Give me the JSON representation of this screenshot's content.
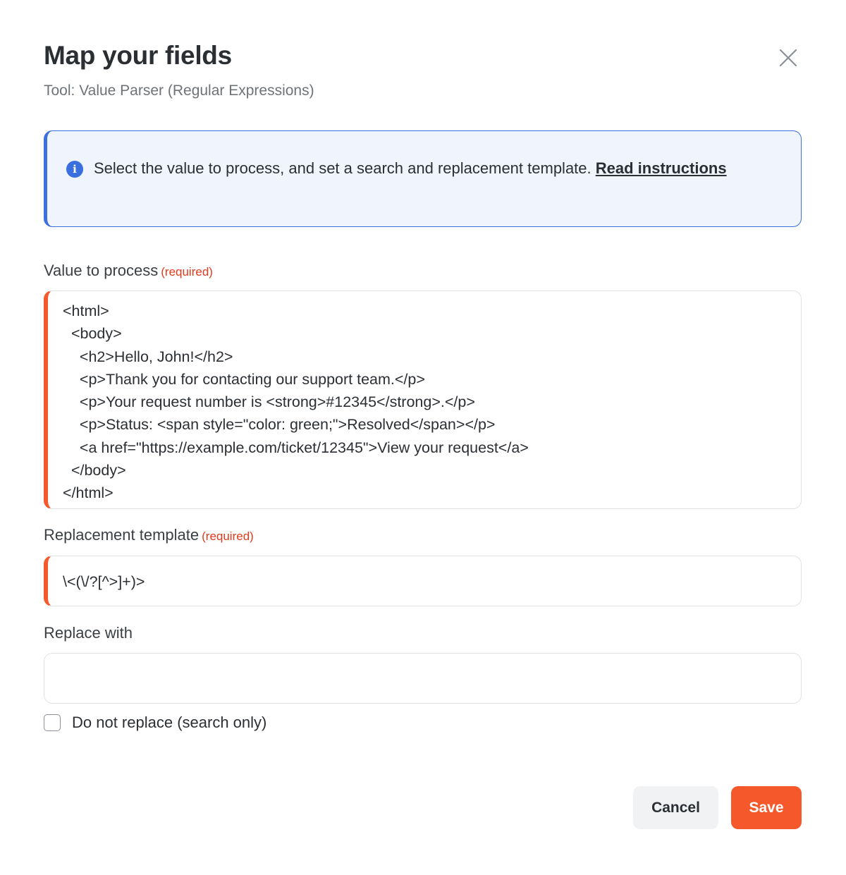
{
  "header": {
    "title": "Map your fields",
    "subtitle": "Tool: Value Parser (Regular Expressions)",
    "close_icon": "close-icon"
  },
  "info": {
    "icon": "info-icon",
    "icon_glyph": "i",
    "text": "Select the value to process, and set a search and replacement template. ",
    "link": "Read instructions",
    "accent_color": "#3a6fe0",
    "background_color": "#eff4fd"
  },
  "fields": {
    "value_to_process": {
      "label": "Value to process",
      "required_label": "(required)",
      "value": "<html>\n  <body>\n    <h2>Hello, John!</h2>\n    <p>Thank you for contacting our support team.</p>\n    <p>Your request number is <strong>#12345</strong>.</p>\n    <p>Status: <span style=\"color: green;\">Resolved</span></p>\n    <a href=\"https://example.com/ticket/12345\">View your request</a>\n  </body>\n</html>"
    },
    "replacement_template": {
      "label": "Replacement template",
      "required_label": "(required)",
      "value": "\\<(\\/?[^>]+)>"
    },
    "replace_with": {
      "label": "Replace with",
      "value": ""
    },
    "search_only": {
      "label": "Do not replace (search only)",
      "checked": false
    }
  },
  "footer": {
    "cancel_label": "Cancel",
    "save_label": "Save"
  },
  "colors": {
    "accent": "#f4582b",
    "required": "#e5391c"
  }
}
